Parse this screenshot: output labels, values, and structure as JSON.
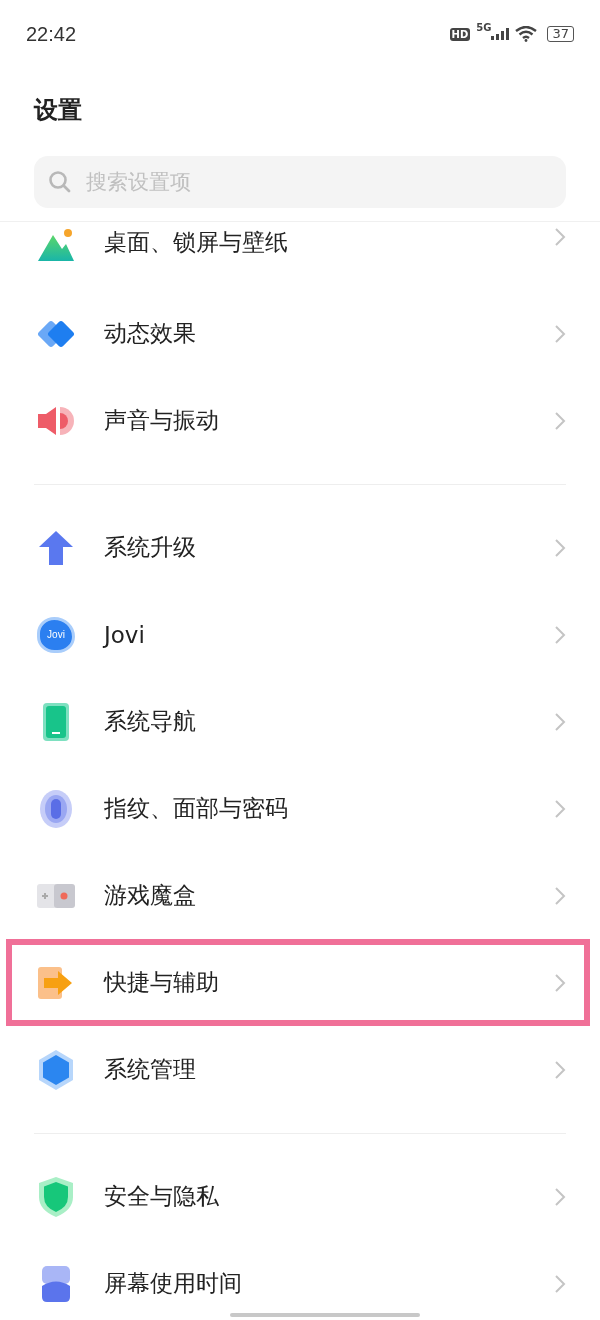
{
  "status_bar": {
    "time": "22:42",
    "hd": "HD",
    "network": "5G",
    "battery": "37"
  },
  "title": "设置",
  "search": {
    "placeholder": "搜索设置项"
  },
  "groups": [
    {
      "items": [
        {
          "label": "桌面、锁屏与壁纸",
          "highlighted": false
        },
        {
          "label": "动态效果",
          "highlighted": false
        },
        {
          "label": "声音与振动",
          "highlighted": false
        }
      ]
    },
    {
      "items": [
        {
          "label": "系统升级",
          "highlighted": false
        },
        {
          "label": "Jovi",
          "icon_text": "Jovi",
          "highlighted": false
        },
        {
          "label": "系统导航",
          "highlighted": false
        },
        {
          "label": "指纹、面部与密码",
          "highlighted": false
        },
        {
          "label": "游戏魔盒",
          "highlighted": false
        },
        {
          "label": "快捷与辅助",
          "highlighted": true
        },
        {
          "label": "系统管理",
          "highlighted": false
        }
      ]
    },
    {
      "items": [
        {
          "label": "安全与隐私",
          "highlighted": false
        },
        {
          "label": "屏幕使用时间",
          "highlighted": false
        }
      ]
    }
  ]
}
